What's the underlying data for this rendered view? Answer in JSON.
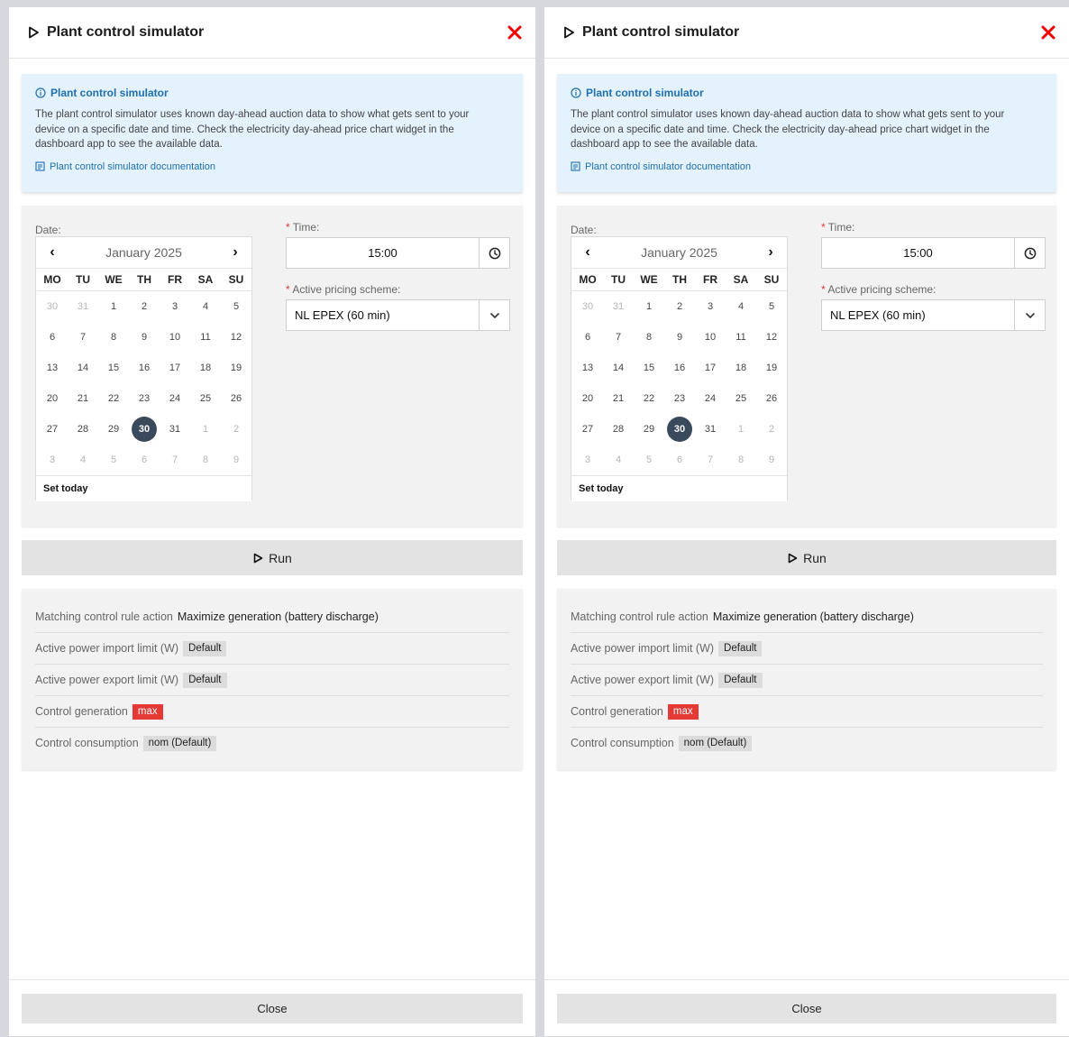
{
  "colors": {
    "accent_blue": "#1f6fb2",
    "danger_red": "#e53935",
    "selected_day": "#3a4a5c"
  },
  "panels": [
    {
      "title": "Plant control simulator",
      "info": {
        "title": "Plant control simulator",
        "text": "The plant control simulator uses known day-ahead auction data to show what gets sent to your device on a specific date and time. Check the electricity day-ahead price chart widget in the dashboard app to see the available data.",
        "link": "Plant control simulator documentation"
      },
      "date_label": "Date:",
      "time_label": "Time:",
      "time_value": "15:00",
      "pricing_label": "Active pricing scheme:",
      "pricing_value": "NL EPEX (60 min)",
      "calendar": {
        "month": "January 2025",
        "weekdays": [
          "MO",
          "TU",
          "WE",
          "TH",
          "FR",
          "SA",
          "SU"
        ],
        "selected_day": "30",
        "set_today": "Set today"
      },
      "run_label": "Run",
      "results": [
        {
          "label": "Matching control rule action",
          "value": "Maximize generation (battery discharge)",
          "style": "plain"
        },
        {
          "label": "Active power import limit (W)",
          "value": "Default",
          "style": "badge"
        },
        {
          "label": "Active power export limit (W)",
          "value": "Default",
          "style": "badge"
        },
        {
          "label": "Control generation",
          "value": "max",
          "style": "red"
        },
        {
          "label": "Control consumption",
          "value": "nom (Default)",
          "style": "badge"
        }
      ],
      "close_label": "Close"
    },
    {
      "title": "Plant control simulator",
      "info": {
        "title": "Plant control simulator",
        "text": "The plant control simulator uses known day-ahead auction data to show what gets sent to your device on a specific date and time. Check the electricity day-ahead price chart widget in the dashboard app to see the available data.",
        "link": "Plant control simulator documentation"
      },
      "date_label": "Date:",
      "time_label": "Time:",
      "time_value": "15:00",
      "pricing_label": "Active pricing scheme:",
      "pricing_value": "NL EPEX (60 min)",
      "calendar": {
        "month": "January 2025",
        "weekdays": [
          "MO",
          "TU",
          "WE",
          "TH",
          "FR",
          "SA",
          "SU"
        ],
        "selected_day": "30",
        "set_today": "Set today"
      },
      "run_label": "Run",
      "results": [
        {
          "label": "Matching control rule action",
          "value": "Maximize generation (battery discharge)",
          "style": "plain"
        },
        {
          "label": "Active power import limit (W)",
          "value": "Default",
          "style": "badge"
        },
        {
          "label": "Active power export limit (W)",
          "value": "Default",
          "style": "badge"
        },
        {
          "label": "Control generation",
          "value": "max",
          "style": "red"
        },
        {
          "label": "Control consumption",
          "value": "nom (Default)",
          "style": "badge"
        }
      ],
      "close_label": "Close"
    }
  ],
  "calendar_days": [
    [
      "30",
      "31",
      "1",
      "2",
      "3",
      "4",
      "5"
    ],
    [
      "6",
      "7",
      "8",
      "9",
      "10",
      "11",
      "12"
    ],
    [
      "13",
      "14",
      "15",
      "16",
      "17",
      "18",
      "19"
    ],
    [
      "20",
      "21",
      "22",
      "23",
      "24",
      "25",
      "26"
    ],
    [
      "27",
      "28",
      "29",
      "30",
      "31",
      "1",
      "2"
    ],
    [
      "3",
      "4",
      "5",
      "6",
      "7",
      "8",
      "9"
    ]
  ],
  "calendar_other_month": [
    [
      true,
      true,
      false,
      false,
      false,
      false,
      false
    ],
    [
      false,
      false,
      false,
      false,
      false,
      false,
      false
    ],
    [
      false,
      false,
      false,
      false,
      false,
      false,
      false
    ],
    [
      false,
      false,
      false,
      false,
      false,
      false,
      false
    ],
    [
      false,
      false,
      false,
      false,
      false,
      true,
      true
    ],
    [
      true,
      true,
      true,
      true,
      true,
      true,
      true
    ]
  ]
}
